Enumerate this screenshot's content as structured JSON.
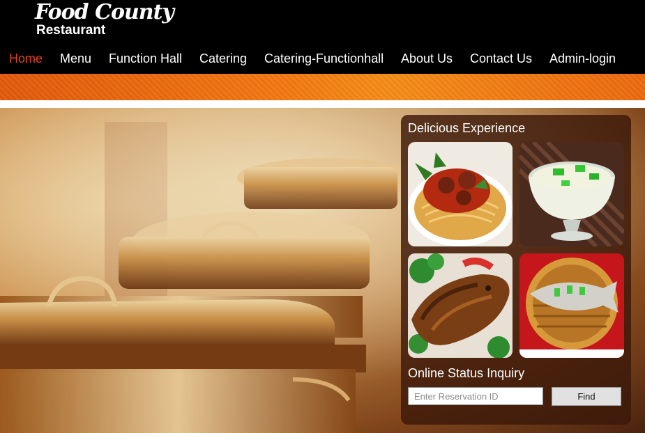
{
  "brand": {
    "title": "Food County",
    "subtitle": "Restaurant"
  },
  "nav": {
    "items": [
      {
        "label": "Home",
        "active": true
      },
      {
        "label": "Menu"
      },
      {
        "label": "Function Hall"
      },
      {
        "label": "Catering"
      },
      {
        "label": "Catering-Functionhall"
      },
      {
        "label": "About Us"
      },
      {
        "label": "Contact Us"
      },
      {
        "label": "Admin-login"
      }
    ]
  },
  "panel": {
    "title": "Delicious Experience",
    "dishes": [
      "spaghetti-meatballs",
      "dessert-cup",
      "grilled-fish",
      "steamed-fish"
    ]
  },
  "inquiry": {
    "title": "Online Status Inquiry",
    "placeholder": "Enter Reservation ID",
    "button": "Find"
  },
  "colors": {
    "nav_active": "#e2401b",
    "stripe": "#f37a12",
    "header_bg": "#000000"
  }
}
